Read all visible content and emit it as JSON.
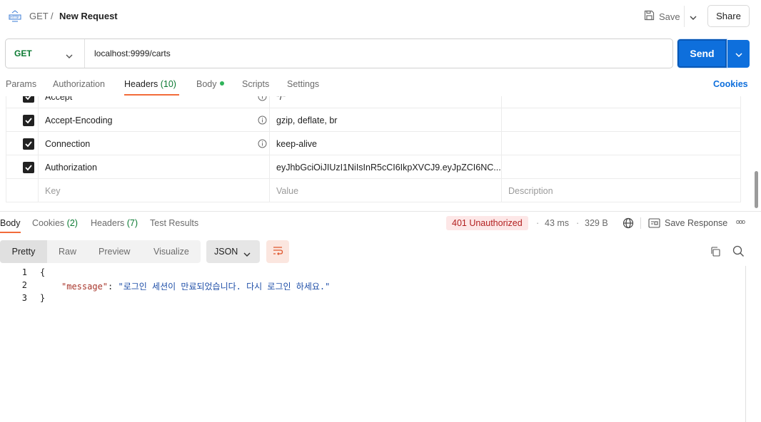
{
  "header": {
    "breadcrumb_method": "GET",
    "breadcrumb_sep": "/",
    "title": "New Request",
    "save_label": "Save",
    "share_label": "Share"
  },
  "request": {
    "method": "GET",
    "url": "localhost:9999/carts",
    "send_label": "Send"
  },
  "request_tabs": [
    {
      "label": "Params"
    },
    {
      "label": "Authorization"
    },
    {
      "label": "Headers",
      "count": "(10)",
      "active": true
    },
    {
      "label": "Body",
      "indicator": "green-dot"
    },
    {
      "label": "Scripts"
    },
    {
      "label": "Settings"
    }
  ],
  "cookies_link": "Cookies",
  "headers_rows": [
    {
      "key": "Accept",
      "value": "*/*",
      "checked": true,
      "info": true
    },
    {
      "key": "Accept-Encoding",
      "value": "gzip, deflate, br",
      "checked": true,
      "info": true
    },
    {
      "key": "Connection",
      "value": "keep-alive",
      "checked": true,
      "info": true
    },
    {
      "key": "Authorization",
      "value": "eyJhbGciOiJIUzI1NiIsInR5cCI6IkpXVCJ9.eyJpZCI6NC...",
      "checked": true,
      "info": false
    }
  ],
  "headers_placeholders": {
    "key": "Key",
    "value": "Value",
    "description": "Description"
  },
  "response_tabs": [
    {
      "label": "Body",
      "active": true
    },
    {
      "label": "Cookies",
      "count": "(2)"
    },
    {
      "label": "Headers",
      "count": "(7)"
    },
    {
      "label": "Test Results"
    }
  ],
  "response_meta": {
    "status": "401 Unauthorized",
    "time": "43 ms",
    "size": "329 B",
    "save_response": "Save Response",
    "more": "ooo"
  },
  "view_modes": [
    "Pretty",
    "Raw",
    "Preview",
    "Visualize"
  ],
  "format": "JSON",
  "code_lines": {
    "l1": "{",
    "l2_key": "\"message\"",
    "l2_colon": ": ",
    "l2_value": "\"로그인 세션이 만료되었습니다. 다시 로그인 하세요.\"",
    "l3": "}"
  },
  "line_numbers": [
    "1",
    "2",
    "3"
  ],
  "colors": {
    "accent_orange": "#f26b3a",
    "send_blue": "#0e6fdc",
    "method_green": "#0b7a32",
    "status_red": "#b21f1f"
  }
}
